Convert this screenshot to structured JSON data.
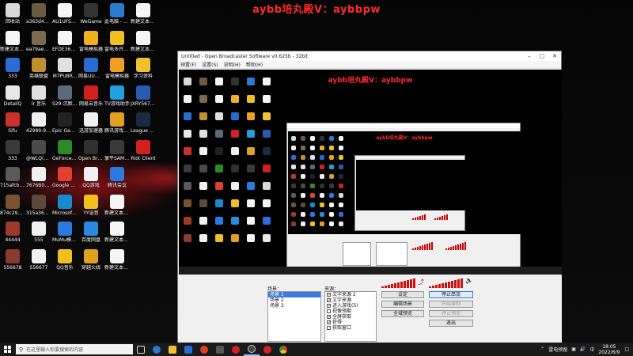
{
  "banner": "aybb培丸殿V：aybbpw",
  "desktop": {
    "icons": [
      {
        "label": "回收站",
        "color": "#d9d9d9"
      },
      {
        "label": "新建文本文档",
        "color": "#f5f5f5"
      },
      {
        "label": "333",
        "color": "#2b6cd6"
      },
      {
        "label": "DetailQ",
        "color": "#e8e8e8"
      },
      {
        "label": "Sifu",
        "color": "#c8322a"
      },
      {
        "label": "333",
        "color": "#3a3a3a"
      },
      {
        "label": "715afcbbe...",
        "color": "#5a5a5a"
      },
      {
        "label": "874c29635...",
        "color": "#7a5230"
      },
      {
        "label": "44444",
        "color": "#9a3a2a"
      },
      {
        "label": "556678",
        "color": "#8a3a30"
      },
      {
        "label": "a363d4dd2...",
        "color": "#6a5a40"
      },
      {
        "label": "ea79ae64e...",
        "color": "#7a6a50"
      },
      {
        "label": "英雄联盟",
        "color": "#c09030"
      },
      {
        "label": "lr 音乐",
        "color": "#e0e0e0"
      },
      {
        "label": "42989-92c...",
        "color": "#f0f0f0"
      },
      {
        "label": "@WLQ(G4...",
        "color": "#4a4a4a"
      },
      {
        "label": "7676B097...",
        "color": "#f0f0f0"
      },
      {
        "label": "315a364B...",
        "color": "#5a4a3a"
      },
      {
        "label": "555",
        "color": "#f0f0f0"
      },
      {
        "label": "556677",
        "color": "#f0f0f0"
      },
      {
        "label": "AU1UFSKZ...",
        "color": "#f5f5f5"
      },
      {
        "label": "EFDE360A...",
        "color": "#f5f5f5"
      },
      {
        "label": "M7PUBR...",
        "color": "#e0e0e0"
      },
      {
        "label": "S29-沉默吧-社群线",
        "color": "#5a6a7a"
      },
      {
        "label": "Epic Games Launcher",
        "color": "#222222"
      },
      {
        "label": "GeForce Experience",
        "color": "#2a8a2a"
      },
      {
        "label": "Google Chrome",
        "color": "#e04030"
      },
      {
        "label": "Microsoft Edge",
        "color": "#1a8ad0"
      },
      {
        "label": "MuMu模拟器",
        "color": "#2a7ae0"
      },
      {
        "label": "QQ音乐",
        "color": "#f0c020"
      },
      {
        "label": "WeGame",
        "color": "#333333"
      },
      {
        "label": "雷电模拟器",
        "color": "#f0b020"
      },
      {
        "label": "网易UU加速器",
        "color": "#2a6ad0"
      },
      {
        "label": "网易云音乐",
        "color": "#d02020"
      },
      {
        "label": "迅游加速器",
        "color": "#f0f0f0"
      },
      {
        "label": "Open Broadcaster",
        "color": "#303030"
      },
      {
        "label": "QQ游戏",
        "color": "#f0f0f0"
      },
      {
        "label": "YY语音",
        "color": "#f0c020"
      },
      {
        "label": "百度网盘",
        "color": "#2a8ae0"
      },
      {
        "label": "穿越火线",
        "color": "#e0a020"
      },
      {
        "label": "此电脑 - 快捷方式",
        "color": "#2a7ad0"
      },
      {
        "label": "雷电多开器4",
        "color": "#f0c020"
      },
      {
        "label": "雷电模拟器",
        "color": "#f0a020"
      },
      {
        "label": "TV游戏助手",
        "color": "#20a0e0"
      },
      {
        "label": "腾讯游戏平台",
        "color": "#e0a020"
      },
      {
        "label": "掌平SAMT...",
        "color": "#3a3a3a"
      },
      {
        "label": "腾讯会议",
        "color": "#2a7ae0"
      },
      {
        "label": "新建文本文档 (2)",
        "color": "#f5f5f5"
      },
      {
        "label": "新建文本文档 (3)",
        "color": "#f5f5f5"
      },
      {
        "label": "新建文本文档 (4)",
        "color": "#f5f5f5"
      },
      {
        "label": "新建文本文档 (5)",
        "color": "#f5f5f5"
      },
      {
        "label": "新建文本文档",
        "color": "#f5f5f5"
      },
      {
        "label": "学习资料",
        "color": "#f0c030"
      },
      {
        "label": "JXRY567 - ...",
        "color": "#2a5ab0"
      },
      {
        "label": "League of Legends",
        "color": "#1a2a40"
      },
      {
        "label": "Riot Client",
        "color": "#d02020"
      }
    ]
  },
  "obs": {
    "title": "Untitled - Open Broadcaster Software v0.625b - 32bit",
    "menu": [
      "预置(F)",
      "设置(S)",
      "说明(H)",
      "帮助(H)"
    ],
    "preview_banner": "aybb培丸殿V：aybbpw",
    "scenes_title": "场景：",
    "scenes": [
      "场景 1",
      "场景 2",
      "场景 3"
    ],
    "sources_title": "来源：",
    "sources": [
      {
        "label": "文字来源 2",
        "checked": true
      },
      {
        "label": "文字来源",
        "checked": true
      },
      {
        "label": "进入游戏(5)",
        "checked": true
      },
      {
        "label": "视像预期",
        "checked": false
      },
      {
        "label": "全屏获取",
        "checked": true
      },
      {
        "label": "获得",
        "checked": true
      },
      {
        "label": "获取窗口",
        "checked": false
      }
    ],
    "buttons": {
      "settings": "设定",
      "stop_stream": "停止串流",
      "edit_scene": "编辑场景",
      "start_record": "开始录制",
      "fullscreen": "全域预览",
      "stop_preview": "停止预览",
      "exit": "退出"
    },
    "accent": "#d01010"
  },
  "taskbar": {
    "search_placeholder": "在这里输入你要搜索的内容",
    "tray_text": "雷电预留",
    "time": "18:05",
    "date": "2022/6/9"
  }
}
